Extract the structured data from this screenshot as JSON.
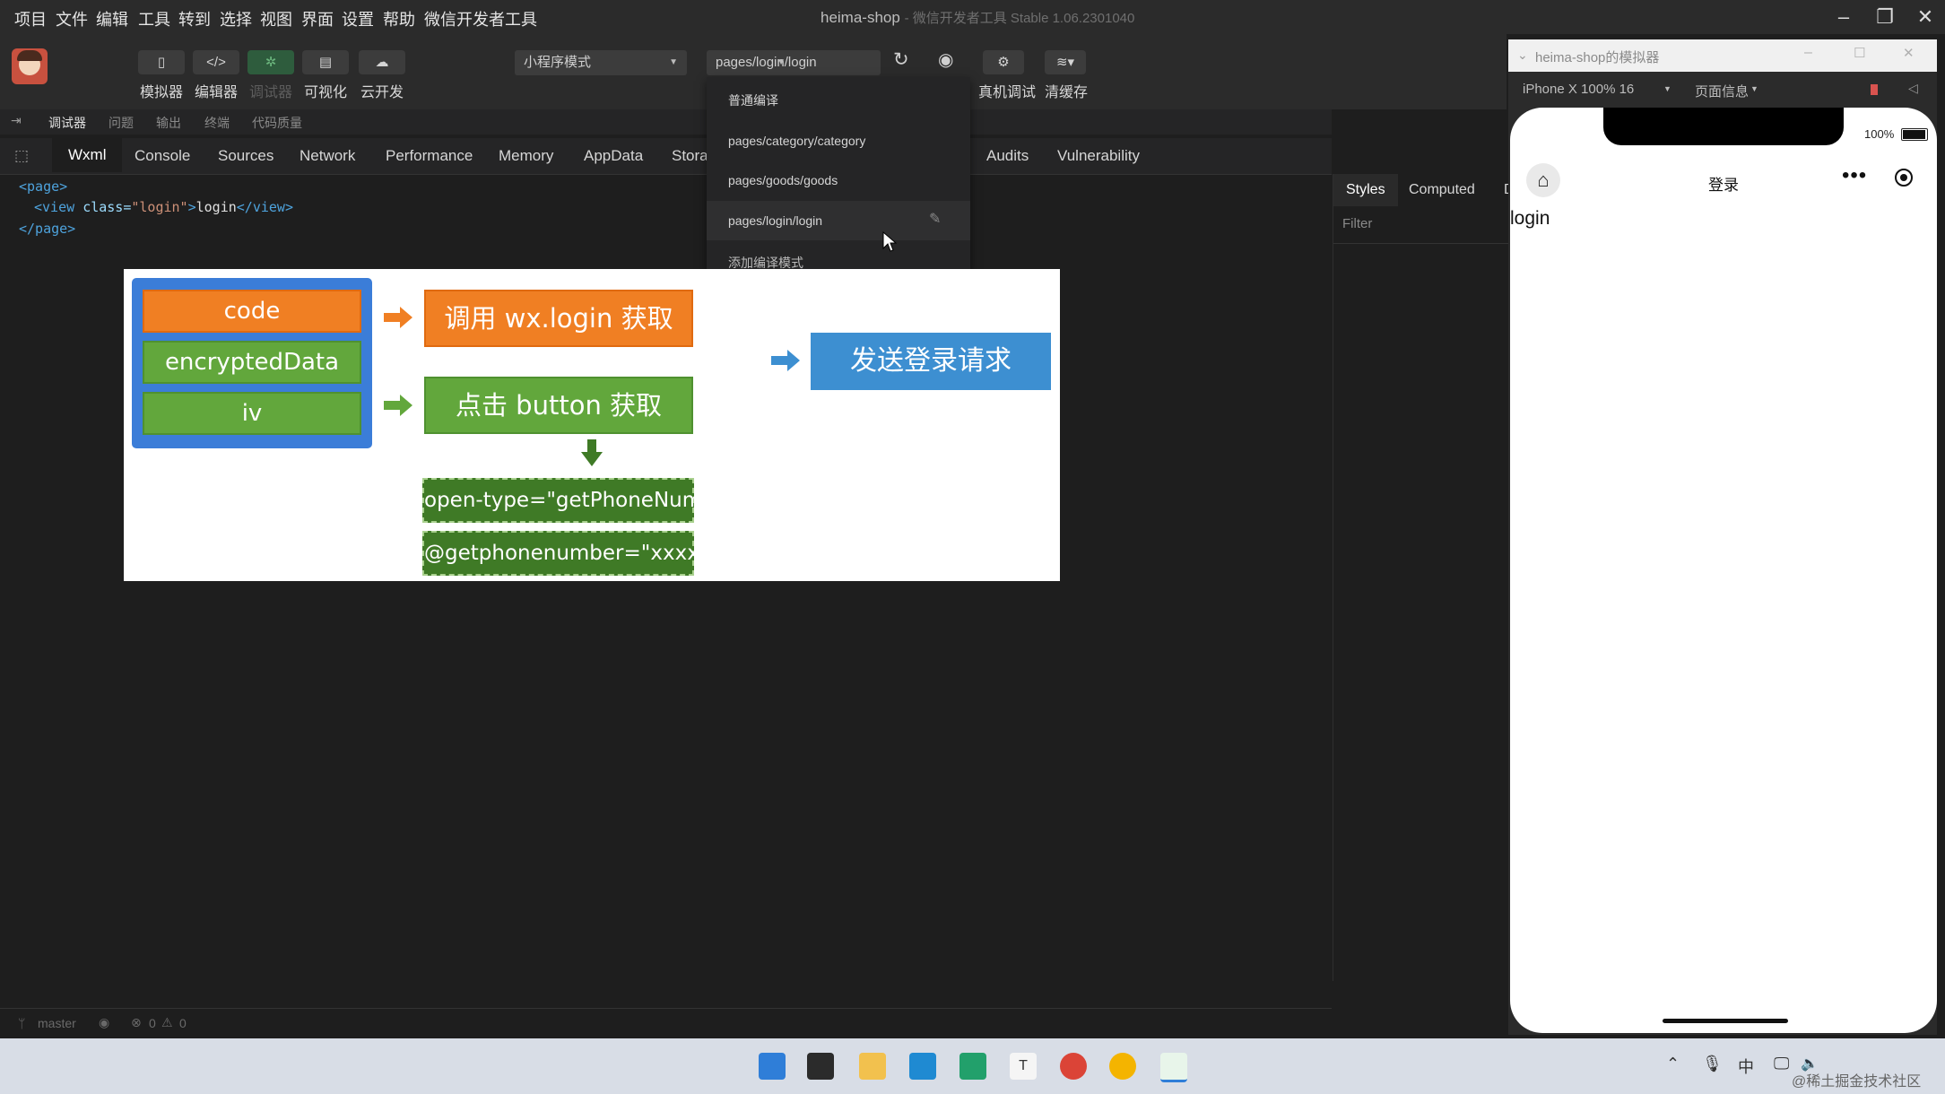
{
  "menubar": {
    "items": [
      "项目",
      "文件",
      "编辑",
      "工具",
      "转到",
      "选择",
      "视图",
      "界面",
      "设置",
      "帮助",
      "微信开发者工具"
    ],
    "title": "heima-shop",
    "title_suffix": "- 微信开发者工具 Stable 1.06.2301040"
  },
  "toolbar": {
    "buttons": [
      "模拟器",
      "编辑器",
      "调试器",
      "可视化",
      "云开发"
    ],
    "mode_select": "小程序模式",
    "page_select": "pages/login/login",
    "right_buttons": [
      "真机调试",
      "清缓存"
    ]
  },
  "compile_dropdown": {
    "items": [
      "普通编译",
      "pages/category/category",
      "pages/goods/goods",
      "pages/login/login",
      "添加编译模式"
    ],
    "selected": "pages/login/login"
  },
  "subtabs": [
    "调试器",
    "问题",
    "输出",
    "终端",
    "代码质量"
  ],
  "devtools_tabs": [
    "Wxml",
    "Console",
    "Sources",
    "Network",
    "Performance",
    "Memory",
    "AppData",
    "Stora",
    "Audits",
    "Vulnerability"
  ],
  "wxml": {
    "line1": "<page>",
    "line2_open": "<view ",
    "line2_attr": "class=",
    "line2_val": "\"login\"",
    "line2_close1": ">",
    "line2_text": "login",
    "line2_close2": "</view>",
    "line3": "</page>"
  },
  "slide": {
    "params": [
      "code",
      "encryptedData",
      "iv"
    ],
    "step_wxlogin": "调用 wx.login 获取",
    "step_button": "点击 button 获取",
    "step_send": "发送登录请求",
    "attr_opentype": "open-type=\"getPhoneNumber\"",
    "attr_event": "@getphonenumber=\"xxxx\""
  },
  "styles_panel": {
    "tabs": [
      "Styles",
      "Computed",
      "D"
    ],
    "filter_placeholder": "Filter"
  },
  "simulator": {
    "window_title": "heima-shop的模拟器",
    "device": "iPhone X 100% 16",
    "page_info": "页面信息",
    "battery": "100%",
    "nav_title": "登录",
    "content_text": "login"
  },
  "statusbar": {
    "branch": "master",
    "errors": "0",
    "warnings": "0"
  },
  "watermark": "@稀土掘金技术社区",
  "taskbar": {
    "tray_lang": "中"
  },
  "colors": {
    "orange": "#f07f23",
    "green": "#62a73c",
    "dark_green": "#3f7a26",
    "blue": "#3d8fd1",
    "panel_border": "#3b7dd8"
  }
}
